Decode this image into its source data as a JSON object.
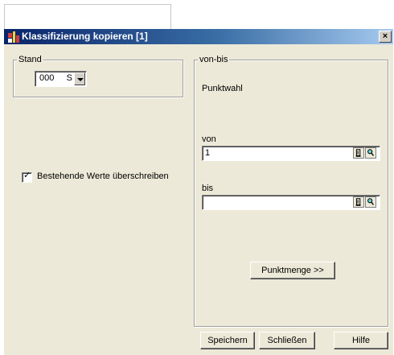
{
  "window": {
    "title": "Klassifizierung kopieren [1]",
    "close_label": "×"
  },
  "stand": {
    "legend": "Stand",
    "selected_value": "000     S"
  },
  "overwrite": {
    "label": "Bestehende Werte überschreiben",
    "checked": true,
    "check_mark": "✓"
  },
  "vonbis": {
    "legend": "von-bis",
    "heading": "Punktwahl",
    "von_label": "von",
    "von_value": "1",
    "bis_label": "bis",
    "bis_value": "",
    "punktmenge_button": "Punktmenge >>"
  },
  "footer": {
    "save_button": "Speichern",
    "close_button": "Schließen",
    "help_button": "Hilfe"
  }
}
